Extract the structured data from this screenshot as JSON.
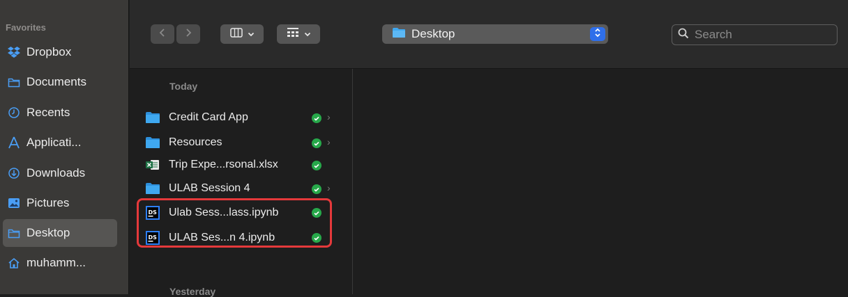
{
  "sidebar": {
    "heading": "Favorites",
    "items": [
      {
        "label": "Dropbox",
        "icon": "dropbox-icon"
      },
      {
        "label": "Documents",
        "icon": "folder-icon"
      },
      {
        "label": "Recents",
        "icon": "clock-icon"
      },
      {
        "label": "Applicati...",
        "icon": "applications-icon"
      },
      {
        "label": "Downloads",
        "icon": "download-icon"
      },
      {
        "label": "Pictures",
        "icon": "pictures-icon"
      },
      {
        "label": "Desktop",
        "icon": "folder-icon",
        "selected": true
      },
      {
        "label": "muhamm...",
        "icon": "home-icon"
      }
    ]
  },
  "toolbar": {
    "path_label": "Desktop",
    "search_placeholder": "Search"
  },
  "column": {
    "sections": [
      "Today",
      "Yesterday"
    ],
    "files": [
      {
        "name": "Credit Card App",
        "type": "folder",
        "status": "synced",
        "has_children": true
      },
      {
        "name": "Resources",
        "type": "folder",
        "status": "synced",
        "has_children": true
      },
      {
        "name": "Trip Expe...rsonal.xlsx",
        "type": "xlsx",
        "status": "synced",
        "has_children": false
      },
      {
        "name": "ULAB Session 4",
        "type": "folder",
        "status": "synced",
        "has_children": true
      },
      {
        "name": "Ulab Sess...lass.ipynb",
        "type": "ipynb",
        "status": "synced",
        "has_children": false
      },
      {
        "name": "ULAB Ses...n 4.ipynb",
        "type": "ipynb",
        "status": "synced",
        "has_children": false
      }
    ]
  },
  "colors": {
    "accent": "#2f6fea",
    "folder": "#3fa8f0",
    "status_green": "#27a84a",
    "highlight": "#e5393b"
  }
}
